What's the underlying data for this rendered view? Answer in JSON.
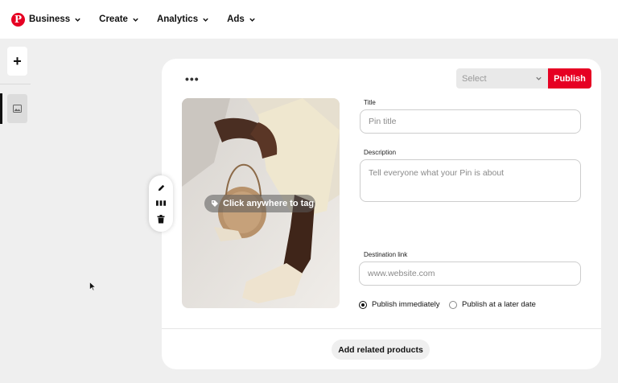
{
  "topbar": {
    "logo_glyph": "P",
    "brand_label": "Business",
    "nav": [
      {
        "label": "Create"
      },
      {
        "label": "Analytics"
      },
      {
        "label": "Ads"
      }
    ]
  },
  "sidebar": {
    "add_label": "+"
  },
  "card": {
    "more_label": "•••",
    "select": {
      "value": "Select"
    },
    "publish_label": "Publish",
    "image": {
      "tag_prompt": "Click anywhere to tag"
    },
    "fields": {
      "title": {
        "label": "Title",
        "placeholder": "Pin title"
      },
      "description": {
        "label": "Description",
        "placeholder": "Tell everyone what your Pin is about"
      },
      "link": {
        "label": "Destination link",
        "placeholder": "www.website.com"
      }
    },
    "publish_options": [
      {
        "label": "Publish immediately",
        "selected": true
      },
      {
        "label": "Publish at a later date",
        "selected": false
      }
    ],
    "related_label": "Add related products"
  },
  "colors": {
    "brand_red": "#e60023",
    "background": "#efefef"
  },
  "icons": [
    "pinterest-logo-icon",
    "chevron-down-icon",
    "image-icon",
    "pencil-icon",
    "layout-icon",
    "trash-icon",
    "tag-icon",
    "cursor-icon"
  ]
}
